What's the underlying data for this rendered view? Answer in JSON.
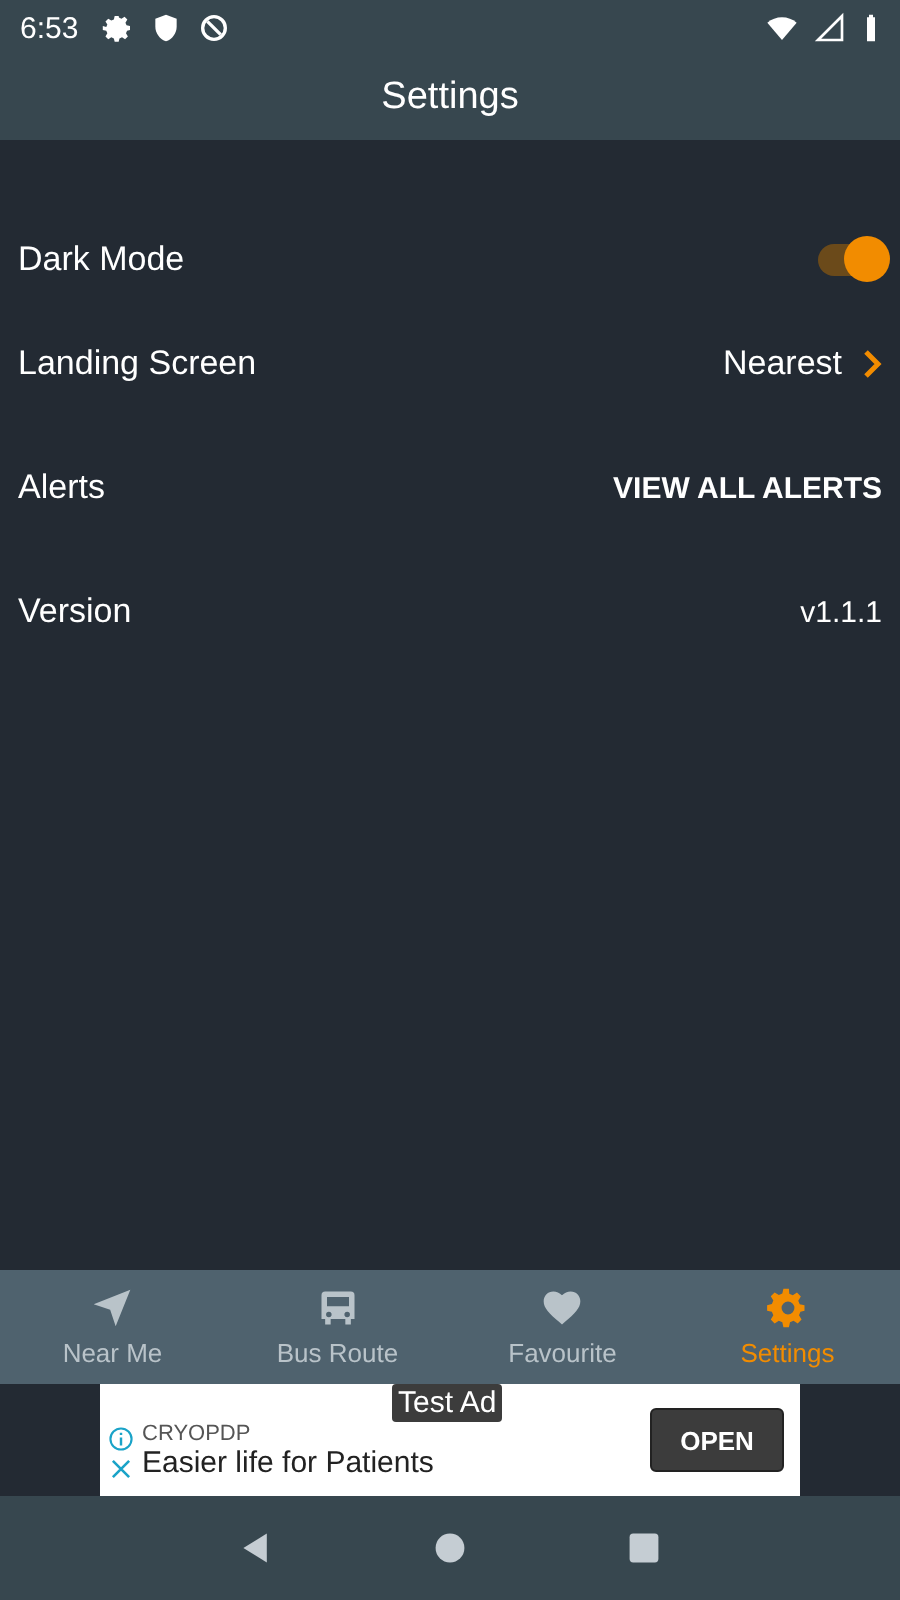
{
  "status_bar": {
    "time": "6:53"
  },
  "app_bar": {
    "title": "Settings"
  },
  "settings": [
    {
      "kind": "toggle",
      "label": "Dark Mode",
      "on": true
    },
    {
      "kind": "link",
      "label": "Landing Screen",
      "value": "Nearest"
    },
    {
      "kind": "button",
      "label": "Alerts",
      "value": "VIEW ALL ALERTS"
    },
    {
      "kind": "value",
      "label": "Version",
      "value": "v1.1.1"
    }
  ],
  "bottom_nav": [
    {
      "label": "Near Me",
      "kind": "nearby",
      "selected": false
    },
    {
      "label": "Bus Route",
      "kind": "route",
      "selected": false
    },
    {
      "label": "Favourite",
      "kind": "favourite",
      "selected": false
    },
    {
      "label": "Settings",
      "kind": "settings",
      "selected": true
    }
  ],
  "ad": {
    "badge": "Test Ad",
    "advertiser": "CRYOPDP",
    "headline": "Easier life for Patients",
    "button": "OPEN"
  }
}
